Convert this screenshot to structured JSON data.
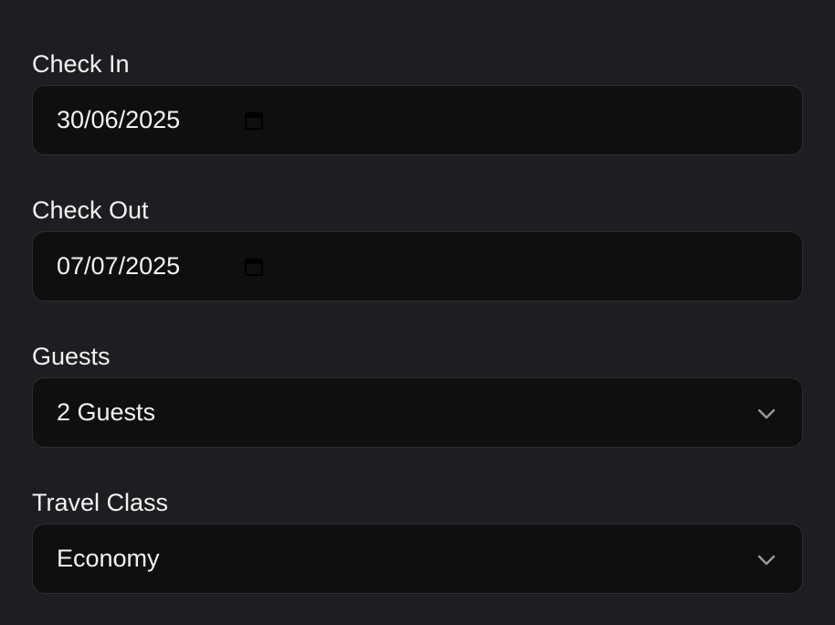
{
  "form": {
    "check_in": {
      "label": "Check In",
      "value": "30/06/2025",
      "icon": "calendar-icon"
    },
    "check_out": {
      "label": "Check Out",
      "value": "07/07/2025",
      "icon": "calendar-icon"
    },
    "guests": {
      "label": "Guests",
      "selected": "2 Guests",
      "icon": "chevron-down-icon"
    },
    "travel_class": {
      "label": "Travel Class",
      "selected": "Economy",
      "icon": "chevron-down-icon"
    }
  },
  "colors": {
    "page_background": "#1d1e21",
    "field_background": "#0f0f10",
    "field_border": "#2c2d31",
    "text": "#f2f2f2",
    "icon_muted": "#9a9a9e"
  }
}
